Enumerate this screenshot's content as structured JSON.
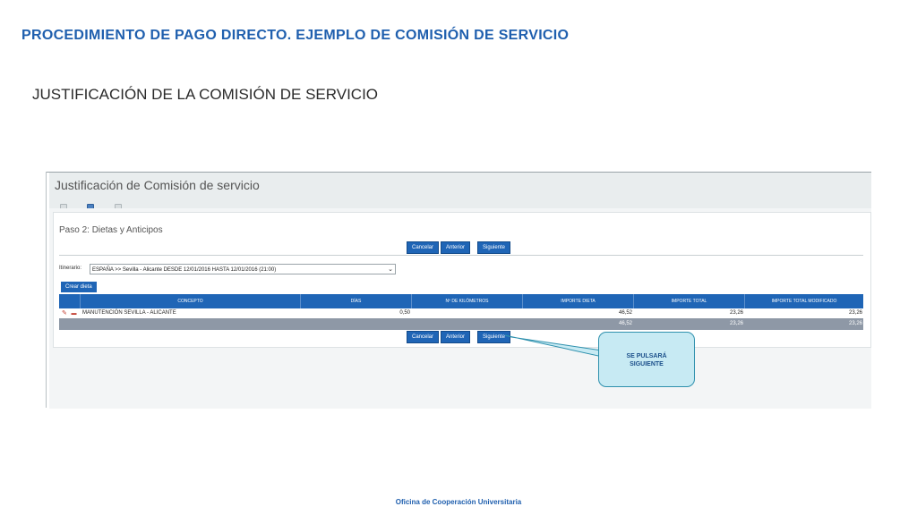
{
  "slide": {
    "title": "PROCEDIMIENTO DE PAGO DIRECTO. EJEMPLO DE COMISIÓN DE SERVICIO",
    "subtitle": "JUSTIFICACIÓN DE LA COMISIÓN DE SERVICIO",
    "footer": "Oficina de Cooperación Universitaria"
  },
  "app": {
    "title": "Justificación de Comisión de servicio",
    "step_title": "Paso 2: Dietas y Anticipos",
    "buttons": {
      "cancel": "Cancelar",
      "previous": "Anterior",
      "next": "Siguiente"
    },
    "itinerary": {
      "label": "Itinerario:",
      "value": "ESPAÑA >> Sevilla - Alicante DESDE 12/01/2016 HASTA 12/01/2016 (21:00)"
    },
    "create_button": "Crear dieta",
    "table": {
      "headers": [
        "CONCEPTO",
        "DÍAS",
        "Nº DE KILÓMETROS",
        "IMPORTE DIETA",
        "IMPORTE TOTAL",
        "IMPORTE TOTAL MODIFICADO"
      ],
      "rows": [
        {
          "concepto": "MANUTENCIÓN SEVILLA - ALICANTE",
          "dias": "0,50",
          "km": "",
          "importe_dieta": "46,52",
          "importe_total": "23,26",
          "importe_total_modificado": "23,26"
        }
      ],
      "totals": {
        "importe_dieta": "46,52",
        "importe_total": "23,26",
        "importe_total_modificado": "23,26"
      }
    }
  },
  "callout": {
    "text": "SE PULSARÁ SIGUIENTE"
  },
  "colors": {
    "accent": "#1f65b6",
    "title_blue": "#1f5fae",
    "callout_fill": "#c7eaf3",
    "callout_border": "#2e90ad"
  }
}
